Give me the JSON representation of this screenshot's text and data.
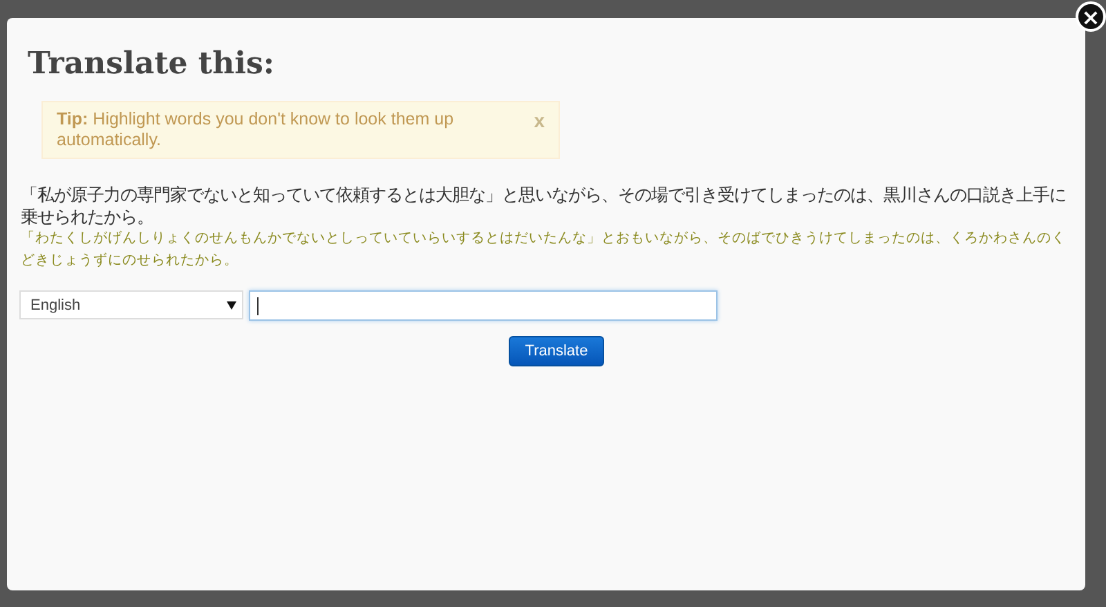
{
  "dialog": {
    "title": "Translate this:",
    "close": "×",
    "tip": {
      "label": "Tip:",
      "text": "Highlight words you don't know to look them up automatically.",
      "dismiss": "x"
    },
    "sentence": "「私が原子力の専門家でないと知っていて依頼するとは大胆な」と思いながら、その場で引き受けてしまったのは、黒川さんの口説き上手に乗せられたから。",
    "reading": "「わたくしがげんしりょくのせんもんかでないとしっていていらいするとはだいたんな」とおもいながら、そのばでひきうけてしまったのは、くろかわさんのくどきじょうずにのせられたから。",
    "language": "English",
    "button": "Translate"
  }
}
